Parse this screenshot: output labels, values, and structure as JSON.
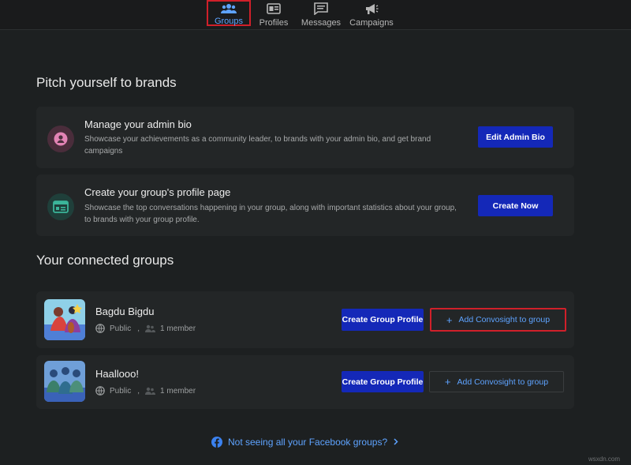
{
  "nav": {
    "items": [
      {
        "label": "Groups",
        "icon": "groups-icon",
        "active": true
      },
      {
        "label": "Profiles",
        "icon": "profile-card-icon"
      },
      {
        "label": "Messages",
        "icon": "messages-icon"
      },
      {
        "label": "Campaigns",
        "icon": "megaphone-icon"
      }
    ]
  },
  "pitch": {
    "title": "Pitch yourself to brands",
    "cards": [
      {
        "title": "Manage your admin bio",
        "description": "Showcase your achievements as a community leader, to brands with your admin bio, and get brand campaigns",
        "button": "Edit Admin Bio",
        "icon": "person-icon"
      },
      {
        "title": "Create your group's profile page",
        "description": "Showcase the top conversations happening in your group, along with important statistics about your group, to brands with your group profile.",
        "button": "Create Now",
        "icon": "profile-page-icon"
      }
    ]
  },
  "groups": {
    "title": "Your connected groups",
    "items": [
      {
        "name": "Bagdu Bigdu",
        "privacy": "Public",
        "separator": ",",
        "members": "1 member",
        "primary_button": "Create Group Profile",
        "secondary_button": "Add Convosight to group"
      },
      {
        "name": "Haallooo!",
        "privacy": "Public",
        "separator": ",",
        "members": "1 member",
        "primary_button": "Create Group Profile",
        "secondary_button": "Add Convosight to group"
      }
    ]
  },
  "footer": {
    "link": "Not seeing all your Facebook groups?"
  },
  "watermark": "wsxdn.com",
  "colors": {
    "accent": "#5ea3ff",
    "primary_button": "#1428b8",
    "highlight": "#d0202a",
    "background": "#1d2021"
  }
}
